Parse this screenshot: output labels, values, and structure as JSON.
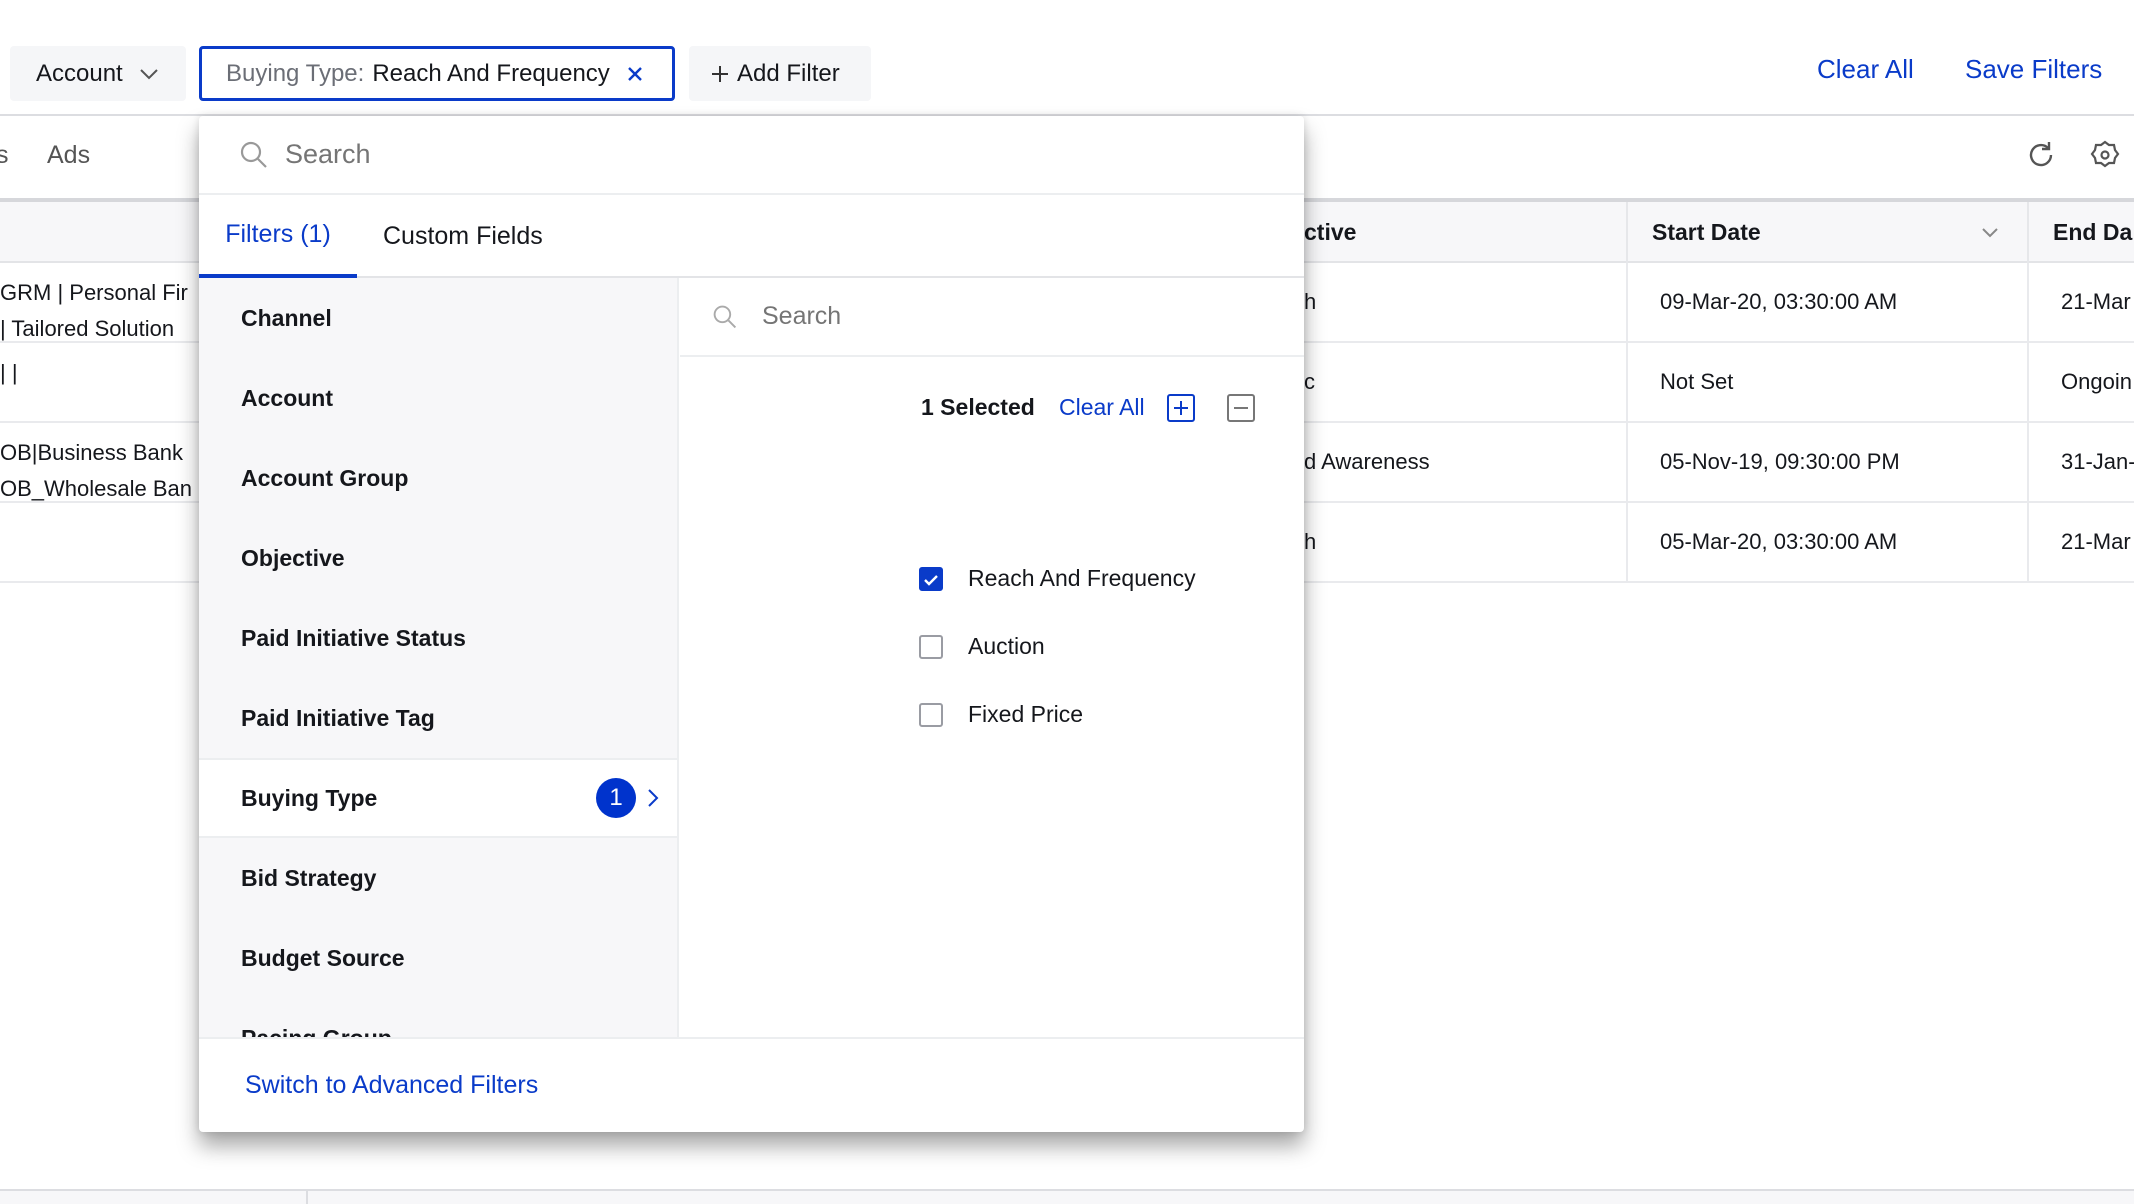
{
  "filter_bar": {
    "account_label": "Account",
    "active_filter_key": "Buying Type:",
    "active_filter_value": "Reach And Frequency",
    "add_filter_label": "Add Filter",
    "clear_all": "Clear All",
    "save_filters": "Save Filters"
  },
  "tabs": {
    "partial": "s",
    "ads": "Ads"
  },
  "table": {
    "headers": [
      "ctive",
      "Start Date",
      "End Da"
    ],
    "left_cells": [
      [
        "GRM | Personal Fir",
        "| Tailored Solution"
      ],
      [
        "| |",
        ""
      ],
      [
        "OB|Business Bank",
        "OB_Wholesale Ban"
      ],
      [
        "",
        ""
      ]
    ],
    "rows": [
      {
        "objective": "h",
        "start": "09-Mar-20, 03:30:00 AM",
        "end": "21-Mar"
      },
      {
        "objective": "c",
        "start": "Not Set",
        "end": "Ongoin"
      },
      {
        "objective": "d Awareness",
        "start": "05-Nov-19, 09:30:00 PM",
        "end": "31-Jan-"
      },
      {
        "objective": "h",
        "start": "05-Mar-20, 03:30:00 AM",
        "end": "21-Mar"
      }
    ]
  },
  "dropdown": {
    "search_placeholder": "Search",
    "tabs": [
      {
        "label": "Filters (1)",
        "active": true
      },
      {
        "label": "Custom Fields",
        "active": false
      }
    ],
    "fields": [
      {
        "label": "Channel"
      },
      {
        "label": "Account"
      },
      {
        "label": "Account Group"
      },
      {
        "label": "Objective"
      },
      {
        "label": "Paid Initiative Status"
      },
      {
        "label": "Paid Initiative Tag"
      },
      {
        "label": "Buying Type",
        "badge": "1",
        "selected": true
      },
      {
        "label": "Bid Strategy"
      },
      {
        "label": "Budget Source"
      },
      {
        "label": "Pacing Group"
      }
    ],
    "values_search_placeholder": "Search",
    "selected_count": "1 Selected",
    "clear_all": "Clear All",
    "options": [
      {
        "label": "Reach And Frequency",
        "checked": true
      },
      {
        "label": "Auction",
        "checked": false
      },
      {
        "label": "Fixed Price",
        "checked": false
      }
    ],
    "footer_link": "Switch to Advanced Filters"
  },
  "colors": {
    "accent": "#0a3bc9",
    "badge": "#0033cc",
    "panel_list_bg": "#f7f7f9"
  }
}
